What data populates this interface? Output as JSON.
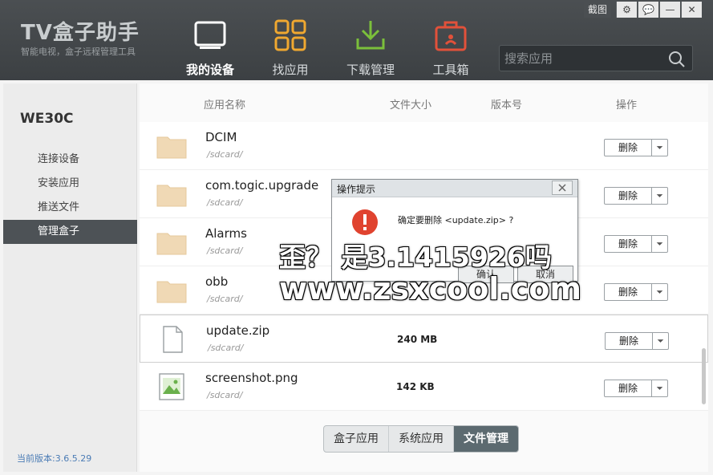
{
  "header": {
    "logo": "TV盒子助手",
    "logo_sub": "智能电视，盒子远程管理工具",
    "window_controls": {
      "screenshot_label": "截图",
      "settings_icon": "gear-icon",
      "feedback_icon": "chat-icon",
      "minimize_icon": "minimize-icon",
      "close_icon": "close-icon"
    },
    "nav": [
      {
        "label": "我的设备",
        "icon": "tv-icon",
        "active": true
      },
      {
        "label": "找应用",
        "icon": "grid-icon"
      },
      {
        "label": "下载管理",
        "icon": "download-icon"
      },
      {
        "label": "工具箱",
        "icon": "toolbox-icon"
      }
    ],
    "search": {
      "placeholder": "搜索应用",
      "icon": "search-icon"
    }
  },
  "sidebar": {
    "device_name": "WE30C",
    "items": [
      {
        "label": "连接设备"
      },
      {
        "label": "安装应用"
      },
      {
        "label": "推送文件"
      },
      {
        "label": "管理盒子",
        "active": true
      }
    ],
    "version": "当前版本:3.6.5.29"
  },
  "table": {
    "columns": [
      "应用名称",
      "文件大小",
      "版本号",
      "操作"
    ],
    "rows": [
      {
        "name": "DCIM",
        "path": "/sdcard/",
        "size": "",
        "icon": "folder-icon",
        "action": "删除"
      },
      {
        "name": "com.togic.upgrade",
        "path": "/sdcard/",
        "size": "",
        "icon": "folder-icon",
        "action": "删除"
      },
      {
        "name": "Alarms",
        "path": "/sdcard/",
        "size": "",
        "icon": "folder-icon",
        "action": "删除"
      },
      {
        "name": "obb",
        "path": "/sdcard/",
        "size": "",
        "icon": "folder-icon",
        "action": "删除"
      },
      {
        "name": "update.zip",
        "path": "/sdcard/",
        "size": "240 MB",
        "icon": "file-icon",
        "action": "删除"
      },
      {
        "name": "screenshot.png",
        "path": "/sdcard/",
        "size": "142 KB",
        "icon": "image-icon",
        "action": "删除"
      }
    ]
  },
  "bottom_tabs": [
    {
      "label": "盒子应用"
    },
    {
      "label": "系统应用"
    },
    {
      "label": "文件管理",
      "active": true
    }
  ],
  "dialog": {
    "title": "操作提示",
    "message": "确定要删除 <update.zip> ?",
    "icon": "warning-icon",
    "confirm": "确认",
    "cancel": "取消"
  },
  "watermark": {
    "line1": "歪？ 是3.1415926吗",
    "line2": "www.zsxcool.com"
  },
  "colors": {
    "header_bg": "#43474a",
    "sidebar_active": "#4d5256",
    "folder": "#f0d9b5",
    "warning": "#e0432f",
    "tab_active": "#5c6a70",
    "version_text": "#4b7cb5"
  }
}
